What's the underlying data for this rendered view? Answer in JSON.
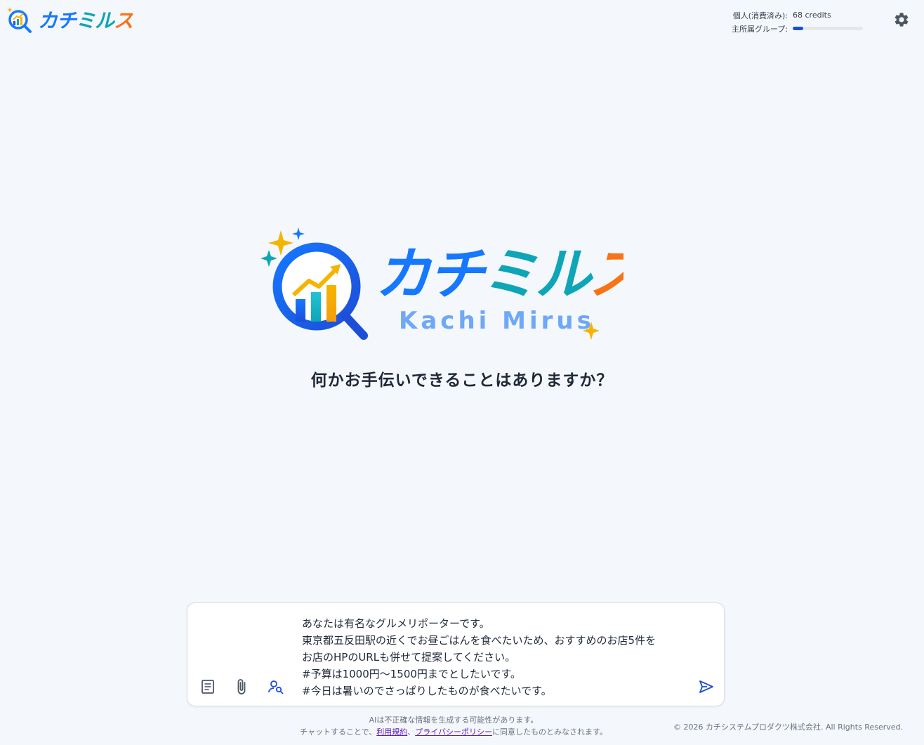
{
  "app": {
    "logo_text": "カチミルス",
    "logo_subtext": "Kachi Mirus"
  },
  "usage": {
    "personal_label": "個人(消費済み):",
    "personal_value": "68 credits",
    "group_label": "主所属グループ:",
    "group_fill_fraction": 0.15
  },
  "main": {
    "prompt_title": "何かお手伝いできることはありますか？"
  },
  "composer": {
    "text": "あなたは有名なグルメリポーターです。\n東京都五反田駅の近くでお昼ごはんを食べたいため、おすすめのお店5件を\nお店のHPのURLも併せて提案してください。\n#予算は1000円〜1500円までとしたいです。\n#今日は暑いのでさっぱりしたものが食べたいです。"
  },
  "footer": {
    "disclaimer": "AIは不正確な情報を生成する可能性があります。",
    "consent_prefix": "チャットすることで、",
    "terms_link": "利用規約",
    "separator": "、",
    "privacy_link": "プライバシーポリシー",
    "consent_suffix": "に同意したものとみなされます。",
    "copyright": "© 2026 カチシステムプロダクツ株式会社. All Rights Reserved."
  },
  "colors": {
    "brand_blue": "#1677ff",
    "brand_teal": "#0ea5b7",
    "brand_orange": "#f97316",
    "accent_gold": "#f5b400",
    "background": "#f4f7fb"
  }
}
